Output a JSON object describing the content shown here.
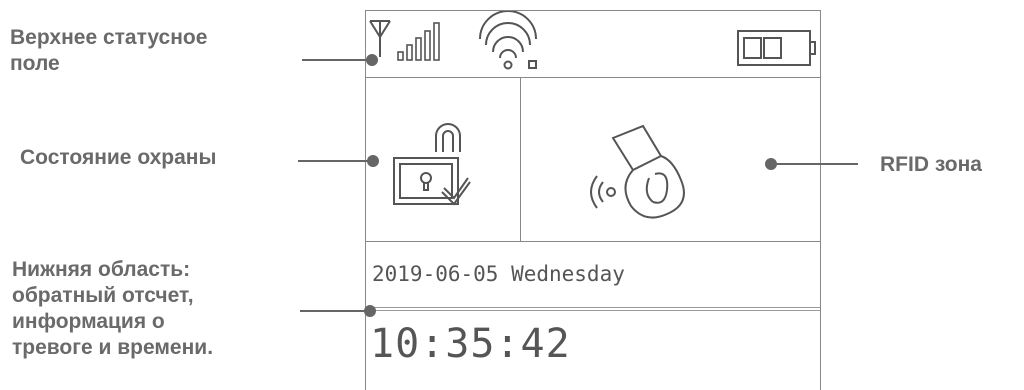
{
  "callouts": {
    "status_bar": [
      "Верхнее статусное",
      "поле"
    ],
    "guard_state": [
      "Состояние охраны"
    ],
    "rfid_zone": [
      "RFID зона"
    ],
    "bottom_area": [
      "Нижняя область:",
      "обратный отсчет,",
      "информация о",
      "тревоге и времени."
    ]
  },
  "screen": {
    "date": "2019-06-05 Wednesday",
    "time": "10:35:42"
  },
  "icons": {
    "antenna": "antenna-icon",
    "signal": "signal-bars-icon",
    "wifi": "wifi-icon",
    "battery": "battery-icon",
    "lock": "unlocked-padlock-icon",
    "rfid": "rfid-card-icon"
  },
  "colors": {
    "callout_text": "#6a6a6a",
    "screen_lines": "#888888",
    "icon_stroke": "#555555"
  }
}
